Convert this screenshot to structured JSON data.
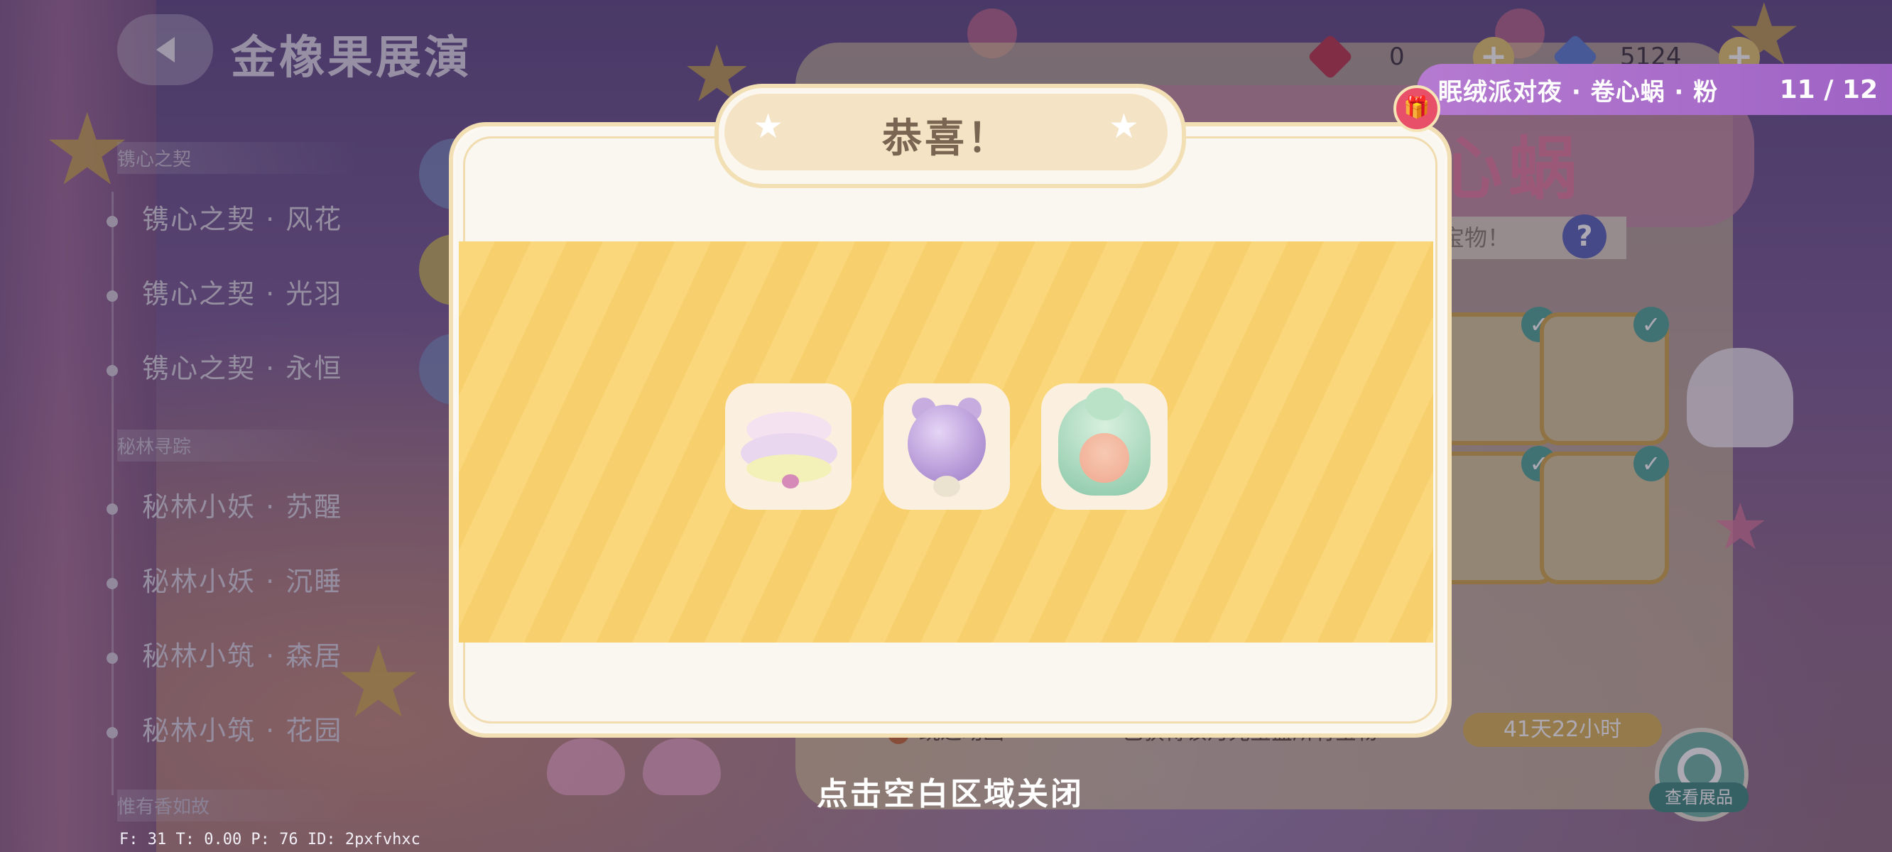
{
  "header": {
    "title": "金橡果展演",
    "back_icon": "back-arrow-icon"
  },
  "catalog": {
    "groups": [
      {
        "label": "镌心之契",
        "items": [
          "镌心之契 · 风花",
          "镌心之契 · 光羽",
          "镌心之契 · 永恒"
        ]
      },
      {
        "label": "秘林寻踪",
        "items": [
          "秘林小妖 · 苏醒",
          "秘林小妖 · 沉睡",
          "秘林小筑 · 森居",
          "秘林小筑 · 花园"
        ]
      },
      {
        "label": "惟有香如故",
        "items": []
      }
    ]
  },
  "currency": {
    "hearts": "0",
    "diamonds": "5124",
    "colors": {
      "heart_gem": "#b8374f",
      "blue_gem": "#5b7fd1"
    }
  },
  "event": {
    "name": "眠绒派对夜 · 卷心蜗 · 粉",
    "progress": "11 / 12"
  },
  "machine": {
    "title": "心蜗",
    "hint": "宝物！",
    "help_label": "?",
    "skip_label": "跳过动画",
    "note": "已获得该月光宝盒所有宝物",
    "timer": "41天22小时",
    "view_label": "查看展品"
  },
  "dialog": {
    "title": "恭喜！",
    "rewards": [
      {
        "name": "lace-skirt-icon"
      },
      {
        "name": "lavender-orb-icon"
      },
      {
        "name": "mint-hair-icon"
      }
    ],
    "close_hint": "点击空白区域关闭"
  },
  "debug": "F: 31    T: 0.00    P: 76    ID: 2pxfvhxc",
  "colors": {
    "dialog_bg": "#faf6f0",
    "header_bg": "#f4e3c4",
    "stripe_a": "#fad77b",
    "stripe_b": "#f8cf6d",
    "event_banner": "#a86bc9"
  }
}
